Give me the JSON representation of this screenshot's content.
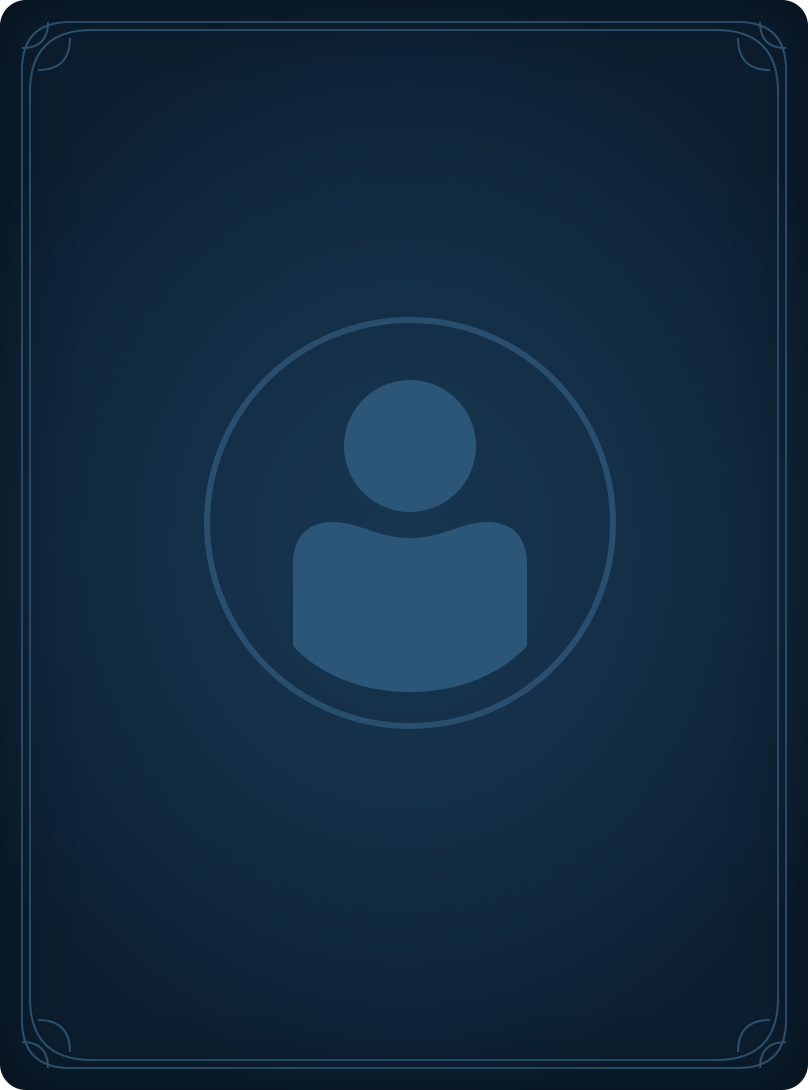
{
  "card": {
    "kind": "placeholder-profile-card",
    "colors": {
      "background": "#132c44",
      "ornament": "#2b4f6c",
      "avatar": "#2b5678",
      "avatar_ring": "#2a4f6e"
    },
    "icons": {
      "avatar": "user-silhouette-icon",
      "corner": "corner-ornament-icon"
    }
  }
}
